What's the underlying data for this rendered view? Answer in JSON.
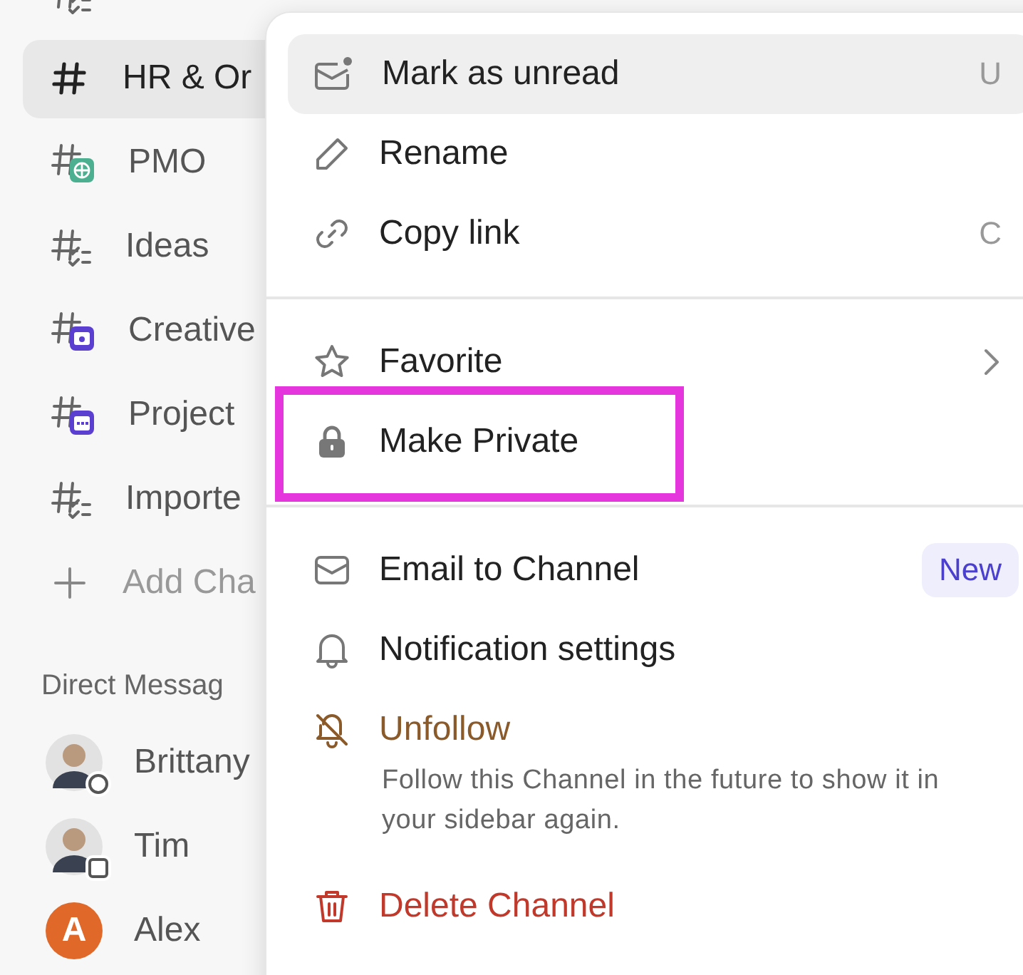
{
  "sidebar": {
    "channels": [
      {
        "kind": "list",
        "selected": false
      },
      {
        "name": "HR & Or",
        "kind": "plain",
        "selected": true
      },
      {
        "name": "PMO",
        "kind": "badge",
        "color": "#4caf8f",
        "selected": false
      },
      {
        "name": "Ideas",
        "kind": "list",
        "selected": false
      },
      {
        "name": "Creative",
        "kind": "badge",
        "color": "#5b3fd0",
        "selected": false
      },
      {
        "name": "Project",
        "kind": "badge",
        "color": "#5b3fd0",
        "selected": false
      },
      {
        "name": "Importe",
        "kind": "list",
        "selected": false
      },
      {
        "name": "Add Cha",
        "kind": "add",
        "selected": false
      }
    ],
    "direct_messages": {
      "title": "Direct Messag",
      "people": [
        {
          "name": "Brittany",
          "kind": "avatar"
        },
        {
          "name": "Tim",
          "kind": "avatar"
        },
        {
          "name": "Alex",
          "kind": "initial",
          "initial": "A",
          "color": "#e0692a"
        }
      ]
    }
  },
  "context_menu": {
    "groups": [
      [
        {
          "label": "Mark as unread",
          "shortcut": "U",
          "highlighted": true,
          "color": "#222222"
        },
        {
          "label": "Rename",
          "highlighted": false,
          "color": "#222222"
        },
        {
          "label": "Copy link",
          "shortcut": "C",
          "highlighted": false,
          "color": "#222222"
        }
      ],
      [
        {
          "label": "Favorite",
          "submenu": true,
          "highlighted": false,
          "color": "#222222"
        },
        {
          "label": "Make Private",
          "highlighted": false,
          "color": "#222222",
          "annotated": true
        }
      ],
      [
        {
          "label": "Email to Channel",
          "badge": "New",
          "highlighted": false,
          "color": "#222222"
        },
        {
          "label": "Notification settings",
          "highlighted": false,
          "color": "#222222"
        },
        {
          "label": "Unfollow",
          "description": "Follow this Channel in the future to show it in your sidebar again.",
          "highlighted": false,
          "color": "#8a5a2b"
        },
        {
          "label": "Delete Channel",
          "highlighted": false,
          "color": "#c0392b"
        }
      ]
    ]
  }
}
